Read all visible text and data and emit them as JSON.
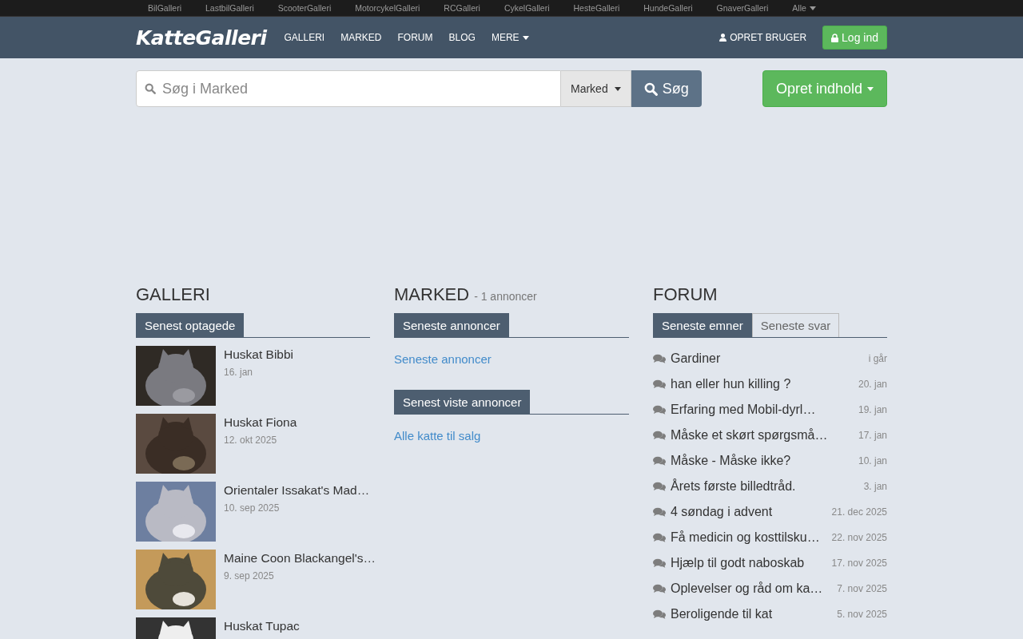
{
  "top_bar": {
    "links": [
      "BilGalleri",
      "LastbilGalleri",
      "ScooterGalleri",
      "MotorcykelGalleri",
      "RCGalleri",
      "CykelGalleri",
      "HesteGalleri",
      "HundeGalleri",
      "GnaverGalleri"
    ],
    "more": "Alle"
  },
  "navbar": {
    "logo": "KatteGalleri",
    "items": [
      {
        "label": "GALLERI",
        "dropdown": false
      },
      {
        "label": "MARKED",
        "dropdown": false
      },
      {
        "label": "FORUM",
        "dropdown": false
      },
      {
        "label": "BLOG",
        "dropdown": false
      },
      {
        "label": "MERE",
        "dropdown": true
      }
    ],
    "register": "OPRET BRUGER",
    "login": "Log ind"
  },
  "search": {
    "placeholder": "Søg i Marked",
    "scope": "Marked",
    "button": "Søg",
    "create": "Opret indhold"
  },
  "galleri": {
    "title": "GALLERI",
    "tab": "Senest optagede",
    "items": [
      {
        "title": "Huskat Bibbi",
        "date": "16. jan"
      },
      {
        "title": "Huskat Fiona",
        "date": "12. okt 2025"
      },
      {
        "title": "Orientaler Issakat's Mad…",
        "date": "10. sep 2025"
      },
      {
        "title": "Maine Coon Blackangel's…",
        "date": "9. sep 2025"
      },
      {
        "title": "Huskat Tupac"
      }
    ]
  },
  "marked": {
    "title": "MARKED",
    "count": "- 1 annoncer",
    "sections": [
      {
        "tab": "Seneste annoncer",
        "link": "Seneste annoncer"
      },
      {
        "tab": "Senest viste annoncer",
        "link": "Alle katte til salg"
      }
    ]
  },
  "forum": {
    "title": "FORUM",
    "tabs": [
      {
        "label": "Seneste emner",
        "selected": true
      },
      {
        "label": "Seneste svar",
        "selected": false
      }
    ],
    "topics": [
      {
        "title": "Gardiner",
        "date": "i går"
      },
      {
        "title": "han eller hun killing ?",
        "date": "20. jan"
      },
      {
        "title": "Erfaring med Mobil-dyrl…",
        "date": "19. jan"
      },
      {
        "title": "Måske et skørt spørgsmå…",
        "date": "17. jan"
      },
      {
        "title": "Måske - Måske ikke?",
        "date": "10. jan"
      },
      {
        "title": "Årets første billedtråd.",
        "date": "3. jan"
      },
      {
        "title": "4 søndag i advent",
        "date": "21. dec 2025"
      },
      {
        "title": "Få medicin og kosttilsku…",
        "date": "22. nov 2025"
      },
      {
        "title": "Hjælp til godt naboskab",
        "date": "17. nov 2025"
      },
      {
        "title": "Oplevelser og råd om ka…",
        "date": "7. nov 2025"
      },
      {
        "title": "Beroligende til kat",
        "date": "5. nov 2025"
      }
    ]
  }
}
